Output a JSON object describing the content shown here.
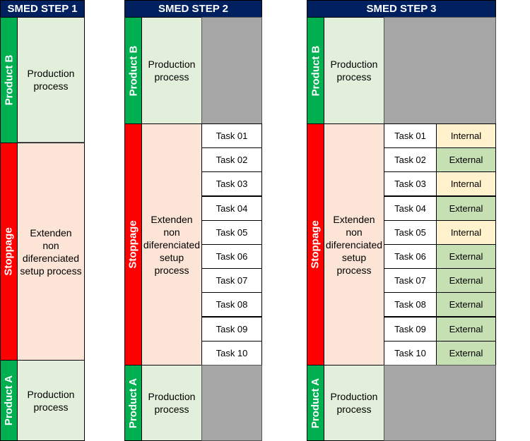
{
  "colors": {
    "header": "#002060",
    "product": "#00b050",
    "stoppage": "#ff0000",
    "production_bg": "#e2efda",
    "setup_bg": "#fce4d6",
    "idle": "#a6a6a6",
    "internal": "#fff2cc",
    "external": "#c6e0b4"
  },
  "steps": [
    {
      "title": "SMED STEP 1",
      "product_b": "Product B",
      "stoppage": "Stoppage",
      "product_a": "Product A",
      "production_b": "Production\nprocess",
      "setup": "Extenden\nnon\ndiferenciated\nsetup process",
      "production_a": "Production\nprocess"
    },
    {
      "title": "SMED STEP 2",
      "product_b": "Product B",
      "stoppage": "Stoppage",
      "product_a": "Product A",
      "production_b": "Production\nprocess",
      "setup": "Extenden\nnon\ndiferenciated\nsetup process",
      "production_a": "Production\nprocess",
      "tasks": [
        "Task 01",
        "Task 02",
        "Task 03",
        "Task 04",
        "Task 05",
        "Task 06",
        "Task 07",
        "Task 08",
        "Task 09",
        "Task 10"
      ]
    },
    {
      "title": "SMED STEP 3",
      "product_b": "Product B",
      "stoppage": "Stoppage",
      "product_a": "Product A",
      "production_b": "Production\nprocess",
      "setup": "Extenden\nnon\ndiferenciated\nsetup process",
      "production_a": "Production\nprocess",
      "tasks": [
        {
          "name": "Task 01",
          "type": "Internal"
        },
        {
          "name": "Task 02",
          "type": "External"
        },
        {
          "name": "Task 03",
          "type": "Internal"
        },
        {
          "name": "Task 04",
          "type": "External"
        },
        {
          "name": "Task 05",
          "type": "Internal"
        },
        {
          "name": "Task 06",
          "type": "External"
        },
        {
          "name": "Task 07",
          "type": "External"
        },
        {
          "name": "Task 08",
          "type": "External"
        },
        {
          "name": "Task 09",
          "type": "External"
        },
        {
          "name": "Task 10",
          "type": "External"
        }
      ]
    }
  ]
}
